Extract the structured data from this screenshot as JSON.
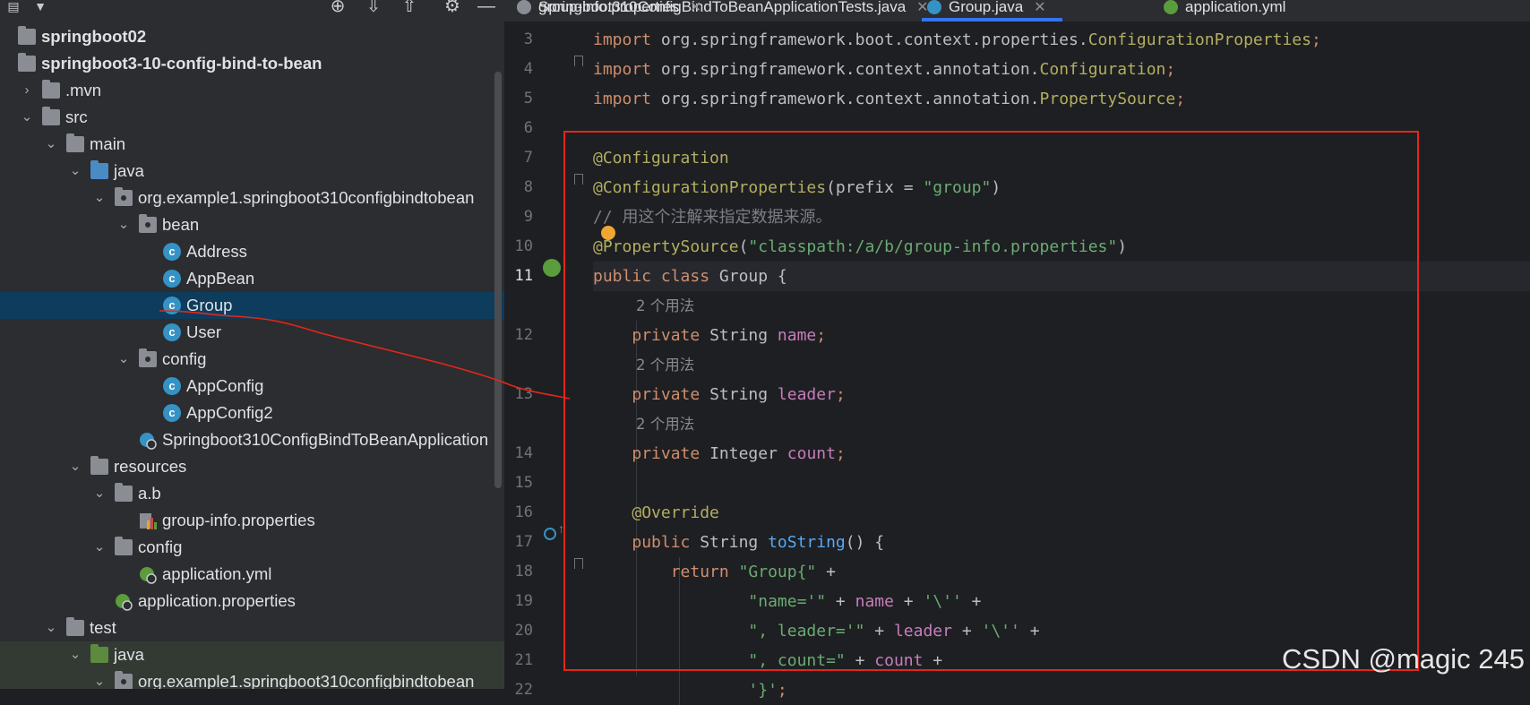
{
  "tree": [
    {
      "label": "springboot02",
      "icon": "module-folder-icon",
      "level": 0,
      "bold": true
    },
    {
      "label": "springboot3-10-config-bind-to-bean",
      "icon": "module-folder-icon",
      "level": 0,
      "bold": true
    },
    {
      "label": ".mvn",
      "icon": "folder-icon",
      "level": 1,
      "chev": "›"
    },
    {
      "label": "src",
      "icon": "folder-icon",
      "level": 1,
      "chev": "⌄"
    },
    {
      "label": "main",
      "icon": "folder-icon",
      "level": 2,
      "chev": "⌄"
    },
    {
      "label": "java",
      "icon": "source-folder-icon",
      "level": 3,
      "chev": "⌄"
    },
    {
      "label": "org.example1.springboot310configbindtobean",
      "icon": "package-icon",
      "level": 4,
      "chev": "⌄"
    },
    {
      "label": "bean",
      "icon": "package-icon",
      "level": 5,
      "chev": "⌄"
    },
    {
      "label": "Address",
      "icon": "class-icon",
      "level": 6
    },
    {
      "label": "AppBean",
      "icon": "class-icon",
      "level": 6
    },
    {
      "label": "Group",
      "icon": "class-icon",
      "level": 6,
      "selected": true
    },
    {
      "label": "User",
      "icon": "class-icon",
      "level": 6
    },
    {
      "label": "config",
      "icon": "package-icon",
      "level": 5,
      "chev": "⌄"
    },
    {
      "label": "AppConfig",
      "icon": "class-icon",
      "level": 6
    },
    {
      "label": "AppConfig2",
      "icon": "class-icon",
      "level": 6
    },
    {
      "label": "Springboot310ConfigBindToBeanApplication",
      "icon": "spring-boot-app-icon",
      "level": 5
    },
    {
      "label": "resources",
      "icon": "resources-folder-icon",
      "level": 3,
      "chev": "⌄"
    },
    {
      "label": "a.b",
      "icon": "folder-icon",
      "level": 4,
      "chev": "⌄"
    },
    {
      "label": "group-info.properties",
      "icon": "properties-file-icon",
      "level": 5
    },
    {
      "label": "config",
      "icon": "folder-icon",
      "level": 4,
      "chev": "⌄"
    },
    {
      "label": "application.yml",
      "icon": "spring-config-icon",
      "level": 5
    },
    {
      "label": "application.properties",
      "icon": "spring-config-icon",
      "level": 4
    },
    {
      "label": "test",
      "icon": "folder-icon",
      "level": 2,
      "chev": "⌄"
    },
    {
      "label": "java",
      "icon": "test-folder-icon",
      "level": 3,
      "chev": "⌄"
    },
    {
      "label": "org.example1.springboot310configbindtobean",
      "icon": "package-icon",
      "level": 4,
      "chev": "⌄"
    }
  ],
  "tabs": [
    {
      "label": "Springboot310ConfigBindToBeanApplicationTests.java",
      "icon": "class-icon"
    },
    {
      "label": "group-info.properties",
      "icon": "properties-file-icon"
    },
    {
      "label": "Group.java",
      "icon": "class-icon",
      "active": true
    },
    {
      "label": "application.yml",
      "icon": "spring-config-icon"
    }
  ],
  "close_glyph": "✕",
  "lines": [
    {
      "num": "3",
      "tokens": [
        [
          "kw",
          "import"
        ],
        [
          "pkg",
          " org.springframework.boot.context.properties."
        ],
        [
          "ann",
          "ConfigurationProperties"
        ],
        [
          "kw",
          ";"
        ]
      ]
    },
    {
      "num": "4",
      "tokens": [
        [
          "kw",
          "import"
        ],
        [
          "pkg",
          " org.springframework.context.annotation."
        ],
        [
          "ann",
          "Configuration"
        ],
        [
          "kw",
          ";"
        ]
      ]
    },
    {
      "num": "5",
      "tokens": [
        [
          "kw",
          "import"
        ],
        [
          "pkg",
          " org.springframework.context.annotation."
        ],
        [
          "ann",
          "PropertySource"
        ],
        [
          "kw",
          ";"
        ]
      ]
    },
    {
      "num": "6",
      "tokens": []
    },
    {
      "num": "7",
      "tokens": [
        [
          "ann",
          "@Configuration"
        ]
      ]
    },
    {
      "num": "8",
      "tokens": [
        [
          "ann",
          "@ConfigurationProperties"
        ],
        [
          "pkg",
          "(prefix = "
        ],
        [
          "str",
          "\"group\""
        ],
        [
          "pkg",
          ")"
        ]
      ]
    },
    {
      "num": "9",
      "tokens": [
        [
          "cmt",
          "// 用这个注解来指定数据来源。"
        ]
      ]
    },
    {
      "num": "10",
      "tokens": [
        [
          "ann",
          "@PropertySource"
        ],
        [
          "pkg",
          "("
        ],
        [
          "str",
          "\"classpath:/a/b/group-info.properties\""
        ],
        [
          "pkg",
          ")"
        ]
      ]
    },
    {
      "num": "11",
      "tokens": [
        [
          "kw",
          "public class "
        ],
        [
          "pkg",
          "Group {"
        ]
      ],
      "current": true
    },
    {
      "hint": "2 个用法"
    },
    {
      "num": "12",
      "tokens": [
        [
          "pkg",
          "    "
        ],
        [
          "kw",
          "private "
        ],
        [
          "pkg",
          "String "
        ],
        [
          "fld",
          "name"
        ],
        [
          "kw",
          ";"
        ]
      ]
    },
    {
      "hint": "2 个用法"
    },
    {
      "num": "13",
      "tokens": [
        [
          "pkg",
          "    "
        ],
        [
          "kw",
          "private "
        ],
        [
          "pkg",
          "String "
        ],
        [
          "fld",
          "leader"
        ],
        [
          "kw",
          ";"
        ]
      ]
    },
    {
      "hint": "2 个用法"
    },
    {
      "num": "14",
      "tokens": [
        [
          "pkg",
          "    "
        ],
        [
          "kw",
          "private "
        ],
        [
          "pkg",
          "Integer "
        ],
        [
          "fld",
          "count"
        ],
        [
          "kw",
          ";"
        ]
      ]
    },
    {
      "num": "15",
      "tokens": []
    },
    {
      "num": "16",
      "tokens": [
        [
          "pkg",
          "    "
        ],
        [
          "ann",
          "@Override"
        ]
      ]
    },
    {
      "num": "17",
      "tokens": [
        [
          "pkg",
          "    "
        ],
        [
          "kw",
          "public "
        ],
        [
          "pkg",
          "String "
        ],
        [
          "fn",
          "toString"
        ],
        [
          "pkg",
          "() {"
        ]
      ]
    },
    {
      "num": "18",
      "tokens": [
        [
          "pkg",
          "        "
        ],
        [
          "kw",
          "return "
        ],
        [
          "str",
          "\"Group{\""
        ],
        [
          "pkg",
          " +"
        ]
      ]
    },
    {
      "num": "19",
      "tokens": [
        [
          "pkg",
          "                "
        ],
        [
          "str",
          "\"name='\""
        ],
        [
          "pkg",
          " + "
        ],
        [
          "fld",
          "name"
        ],
        [
          "pkg",
          " + "
        ],
        [
          "str",
          "'\\''"
        ],
        [
          "pkg",
          " +"
        ]
      ]
    },
    {
      "num": "20",
      "tokens": [
        [
          "pkg",
          "                "
        ],
        [
          "str",
          "\", leader='\""
        ],
        [
          "pkg",
          " + "
        ],
        [
          "fld",
          "leader"
        ],
        [
          "pkg",
          " + "
        ],
        [
          "str",
          "'\\''"
        ],
        [
          "pkg",
          " +"
        ]
      ]
    },
    {
      "num": "21",
      "tokens": [
        [
          "pkg",
          "                "
        ],
        [
          "str",
          "\", count=\""
        ],
        [
          "pkg",
          " + "
        ],
        [
          "fld",
          "count"
        ],
        [
          "pkg",
          " +"
        ]
      ]
    },
    {
      "num": "22",
      "tokens": [
        [
          "pkg",
          "                "
        ],
        [
          "str",
          "'}'"
        ],
        [
          "kw",
          ";"
        ]
      ]
    }
  ],
  "watermark": "CSDN @magic 245",
  "colors": {
    "annotation_box": "#e5261b",
    "selection": "#0e3c5c",
    "active_tab_underline": "#3574f0"
  }
}
